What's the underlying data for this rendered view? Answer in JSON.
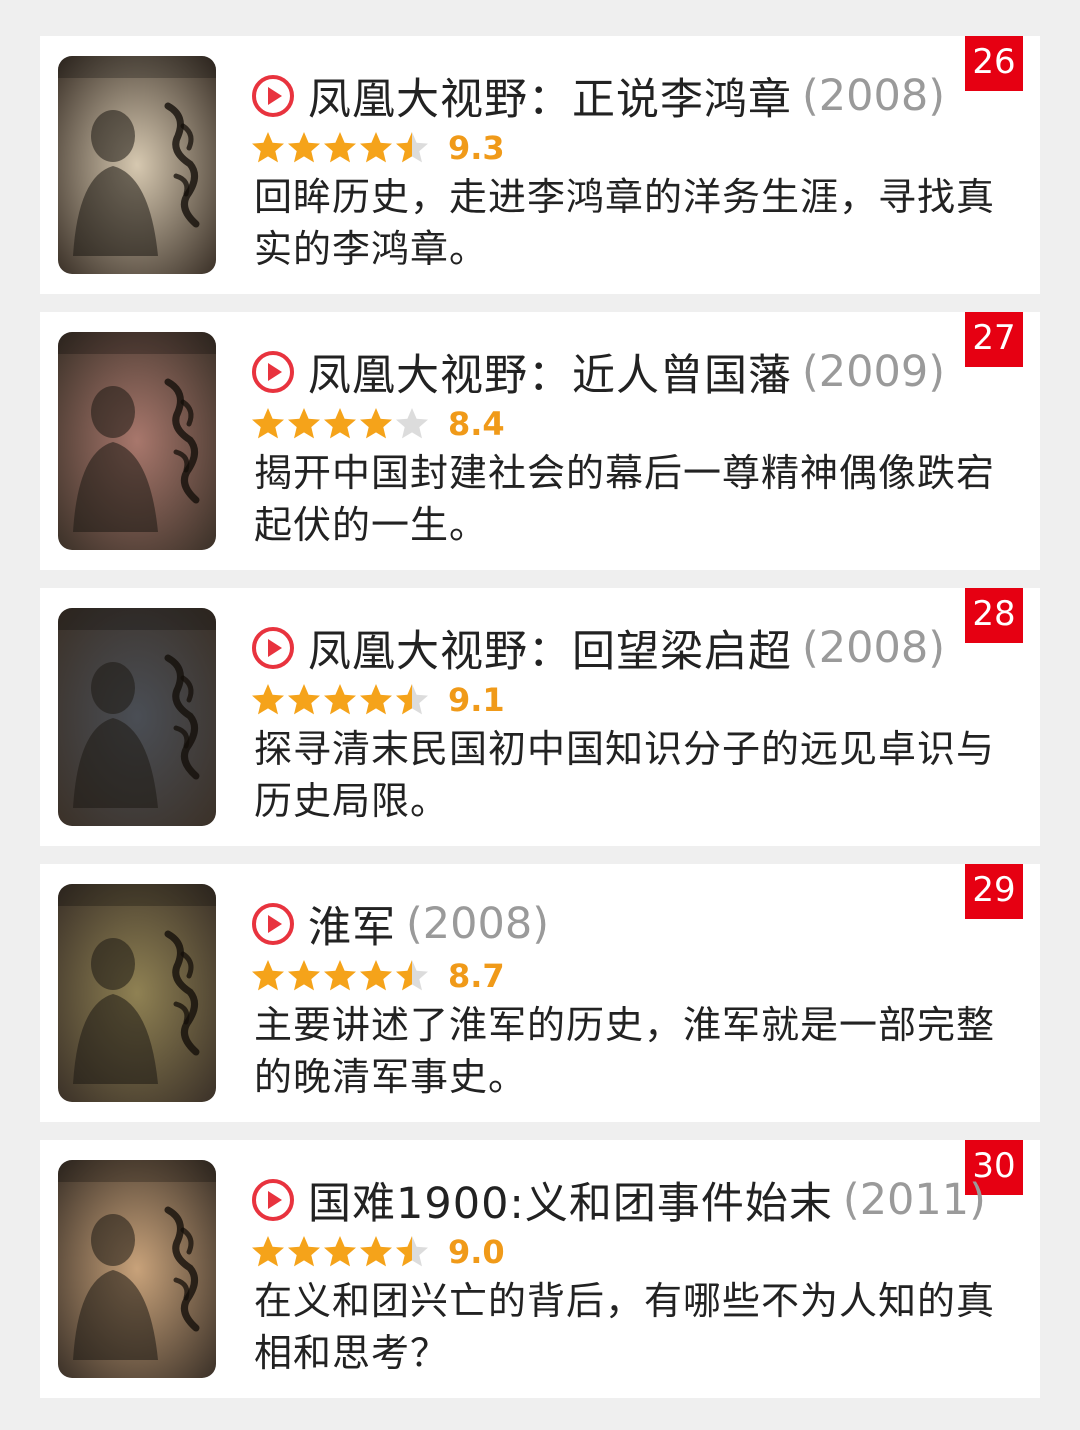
{
  "colors": {
    "background": "#efefef",
    "card": "#ffffff",
    "rank_badge": "#e60012",
    "play_icon": "#e8333e",
    "star_filled": "#f5a31a",
    "star_empty": "#dcdcdc",
    "score": "#f09a19",
    "year": "#9a9a9a"
  },
  "items": [
    {
      "rank": "26",
      "title": "凤凰大视野：正说李鸿章",
      "year": "(2008)",
      "stars": 4.5,
      "score": "9.3",
      "description": "回眸历史，走进李鸿章的洋务生涯，寻找真实的李鸿章。",
      "poster_icon": "documentary-poster-li-hongzhang",
      "poster_tone": "#d6c8b0"
    },
    {
      "rank": "27",
      "title": "凤凰大视野：近人曾国藩",
      "year": "(2009)",
      "stars": 4,
      "score": "8.4",
      "description": "揭开中国封建社会的幕后一尊精神偶像跌宕起伏的一生。",
      "poster_icon": "documentary-poster-zeng-guofan",
      "poster_tone": "#a8776c"
    },
    {
      "rank": "28",
      "title": "凤凰大视野：回望梁启超",
      "year": "(2008)",
      "stars": 4.5,
      "score": "9.1",
      "description": "探寻清末民国初中国知识分子的远见卓识与历史局限。",
      "poster_icon": "documentary-poster-liang-qichao",
      "poster_tone": "#4a4e55"
    },
    {
      "rank": "29",
      "title": "淮军",
      "year": "(2008)",
      "stars": 4.5,
      "score": "8.7",
      "description": "主要讲述了淮军的历史，淮军就是一部完整的晚清军事史。",
      "poster_icon": "documentary-poster-burning-yellow-dragon-flag",
      "poster_tone": "#8f8153"
    },
    {
      "rank": "30",
      "title": "国难1900:义和团事件始末",
      "year": "(2011)",
      "stars": 4.5,
      "score": "9.0",
      "description": "在义和团兴亡的背后，有哪些不为人知的真相和思考？",
      "poster_icon": "documentary-poster-boxer-rebellion",
      "poster_tone": "#c8a27a"
    }
  ]
}
